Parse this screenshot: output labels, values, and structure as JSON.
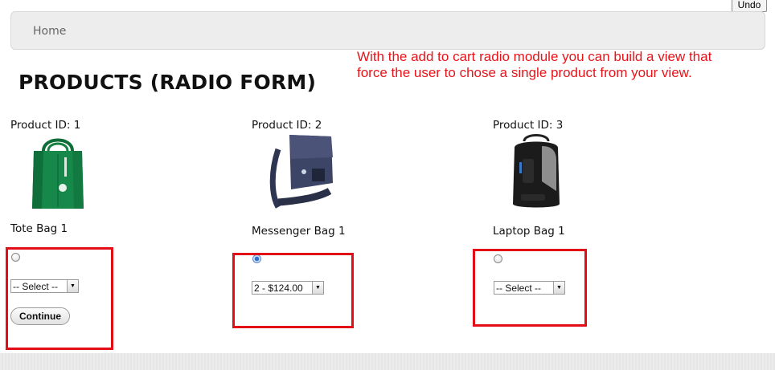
{
  "toolbar": {
    "undo_label": "Undo"
  },
  "nav": {
    "home_label": "Home"
  },
  "annotation": {
    "text": "With the add to cart radio module you can build a view that force the user to chose a single product from your view."
  },
  "page": {
    "title": "PRODUCTS (RADIO FORM)"
  },
  "products": [
    {
      "id_label": "Product ID: 1",
      "name": "Tote Bag 1",
      "image": "tote-bag-image",
      "radio_checked": false,
      "select_value": "-- Select --",
      "image_color": "#16894a"
    },
    {
      "id_label": "Product ID: 2",
      "name": "Messenger Bag 1",
      "image": "messenger-bag-image",
      "radio_checked": true,
      "select_value": "2 - $124.00",
      "image_color": "#3d4566"
    },
    {
      "id_label": "Product ID: 3",
      "name": "Laptop Bag 1",
      "image": "laptop-backpack-image",
      "radio_checked": false,
      "select_value": "-- Select --",
      "image_color": "#1b1b1b"
    }
  ],
  "form": {
    "continue_label": "Continue"
  },
  "colors": {
    "annotation": "#e8141a",
    "highlight_box": "#e20d15",
    "navbar": "#ededed"
  }
}
